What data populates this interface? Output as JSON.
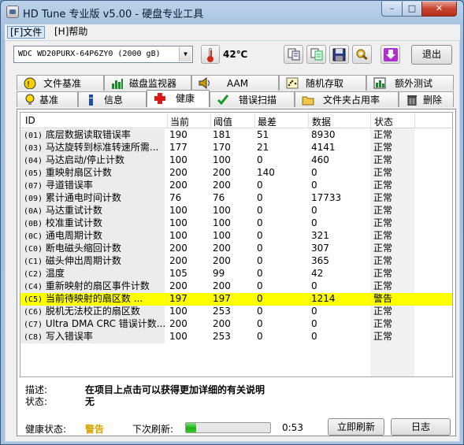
{
  "window": {
    "title": "HD Tune 专业版 v5.00 - 硬盘专业工具",
    "minimize": "–",
    "maximize": "□",
    "close": "✕"
  },
  "menu": {
    "file": "[F]文件",
    "help": "[H]帮助"
  },
  "toolbar": {
    "drive": "WDC    WD20PURX-64P6ZY0 (2000 gB)",
    "temperature": "42℃",
    "exit": "退出"
  },
  "tabs_top": [
    "文件基准",
    "磁盘监视器",
    "AAM",
    "随机存取",
    "额外测试"
  ],
  "tabs_bottom": [
    "基准",
    "信息",
    "健康",
    "错误扫描",
    "文件夹占用率",
    "删除"
  ],
  "active_tab": "健康",
  "table": {
    "headers": [
      "ID",
      "当前",
      "阈值",
      "最差",
      "数据",
      "状态"
    ],
    "rows": [
      {
        "code": "(01)",
        "name": "底层数据读取错误率",
        "current": "190",
        "threshold": "181",
        "worst": "51",
        "data": "8930",
        "status": "正常"
      },
      {
        "code": "(03)",
        "name": "马达旋转到标准转速所需...",
        "current": "177",
        "threshold": "170",
        "worst": "21",
        "data": "4141",
        "status": "正常"
      },
      {
        "code": "(04)",
        "name": "马达启动/停止计数",
        "current": "100",
        "threshold": "100",
        "worst": "0",
        "data": "460",
        "status": "正常"
      },
      {
        "code": "(05)",
        "name": "重映射扇区计数",
        "current": "200",
        "threshold": "200",
        "worst": "140",
        "data": "0",
        "status": "正常"
      },
      {
        "code": "(07)",
        "name": "寻道错误率",
        "current": "200",
        "threshold": "200",
        "worst": "0",
        "data": "0",
        "status": "正常"
      },
      {
        "code": "(09)",
        "name": "累计通电时间计数",
        "current": "76",
        "threshold": "76",
        "worst": "0",
        "data": "17733",
        "status": "正常"
      },
      {
        "code": "(0A)",
        "name": "马达重试计数",
        "current": "100",
        "threshold": "100",
        "worst": "0",
        "data": "0",
        "status": "正常"
      },
      {
        "code": "(0B)",
        "name": "校准重试计数",
        "current": "100",
        "threshold": "100",
        "worst": "0",
        "data": "0",
        "status": "正常"
      },
      {
        "code": "(0C)",
        "name": "通电周期计数",
        "current": "100",
        "threshold": "100",
        "worst": "0",
        "data": "321",
        "status": "正常"
      },
      {
        "code": "(C0)",
        "name": "断电磁头缩回计数",
        "current": "200",
        "threshold": "200",
        "worst": "0",
        "data": "307",
        "status": "正常"
      },
      {
        "code": "(C1)",
        "name": "磁头伸出周期计数",
        "current": "200",
        "threshold": "200",
        "worst": "0",
        "data": "365",
        "status": "正常"
      },
      {
        "code": "(C2)",
        "name": "温度",
        "current": "105",
        "threshold": "99",
        "worst": "0",
        "data": "42",
        "status": "正常"
      },
      {
        "code": "(C4)",
        "name": "重新映射的扇区事件计数",
        "current": "200",
        "threshold": "200",
        "worst": "0",
        "data": "0",
        "status": "正常"
      },
      {
        "code": "(C5)",
        "name": "当前待映射的扇区数 ...",
        "current": "197",
        "threshold": "197",
        "worst": "0",
        "data": "1214",
        "status": "警告"
      },
      {
        "code": "(C6)",
        "name": "脱机无法校正的扇区数",
        "current": "100",
        "threshold": "253",
        "worst": "0",
        "data": "0",
        "status": "正常"
      },
      {
        "code": "(C7)",
        "name": "Ultra DMA CRC 错误计数...",
        "current": "200",
        "threshold": "200",
        "worst": "0",
        "data": "0",
        "status": "正常"
      },
      {
        "code": "(C8)",
        "name": "写入错误率",
        "current": "100",
        "threshold": "253",
        "worst": "0",
        "data": "0",
        "status": "正常"
      }
    ]
  },
  "description": {
    "desc_label": "描述:",
    "desc_value": "在项目上点击可以获得更加详细的有关说明",
    "status_label": "状态:",
    "status_value": "无"
  },
  "footer": {
    "health_label": "健康状态:",
    "health_value": "警告",
    "refresh_label": "下次刷新:",
    "refresh_progress": 0.12,
    "refresh_time": "0:53",
    "refresh_now": "立即刷新",
    "log": "日志"
  },
  "colors": {
    "warning_row": "#ffff00",
    "warning_text": "#d8a400",
    "progress": "#1fb21a"
  }
}
